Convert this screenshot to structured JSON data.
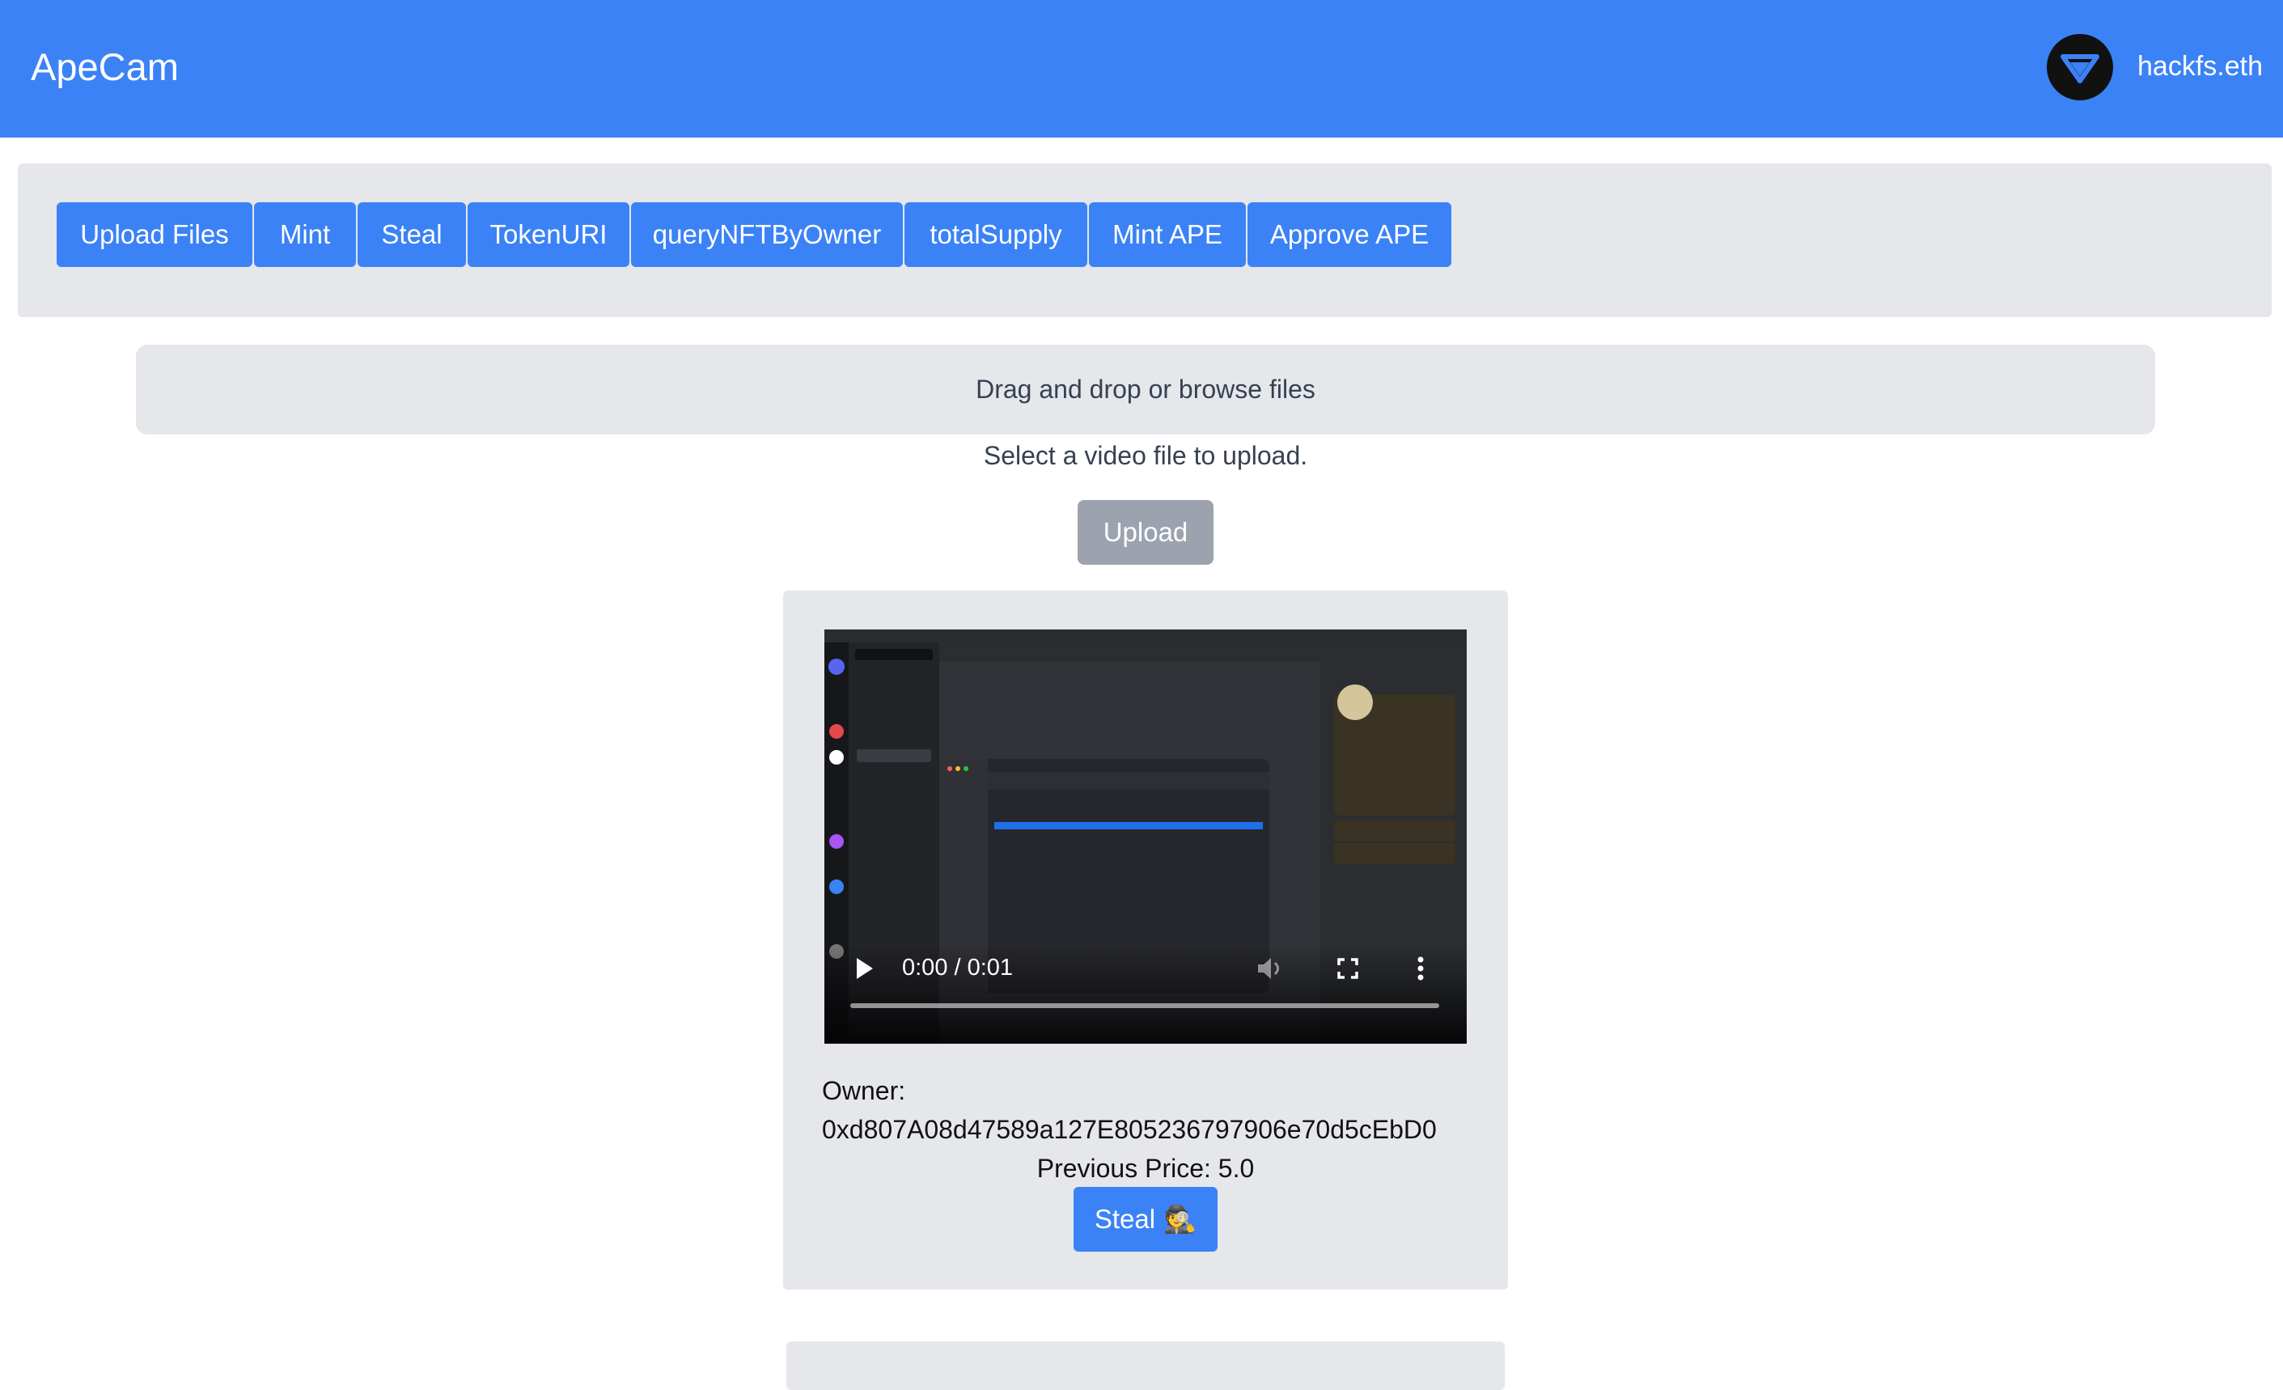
{
  "header": {
    "brand": "ApeCam",
    "username": "hackfs.eth",
    "avatar_icon": "gem-logo-icon"
  },
  "tabs": [
    {
      "label": "Upload Files"
    },
    {
      "label": "Mint"
    },
    {
      "label": "Steal"
    },
    {
      "label": "TokenURI"
    },
    {
      "label": "queryNFTByOwner"
    },
    {
      "label": "totalSupply"
    },
    {
      "label": "Mint APE"
    },
    {
      "label": "Approve APE"
    }
  ],
  "upload": {
    "dropzone_text": "Drag and drop or browse files",
    "hint": "Select a video file to upload.",
    "button_label": "Upload"
  },
  "nft_card": {
    "video": {
      "time_display": "0:00 / 0:01",
      "progress": 0
    },
    "owner_label": "Owner:",
    "owner_address": "0xd807A08d47589a127E805236797906e70d5cEbD0",
    "previous_price": "Previous Price: 5.0",
    "steal_label": "Steal",
    "steal_emoji": "🕵"
  },
  "colors": {
    "primary": "#3b82f6",
    "panel": "#e5e7eb",
    "disabled": "#9ca3af"
  }
}
